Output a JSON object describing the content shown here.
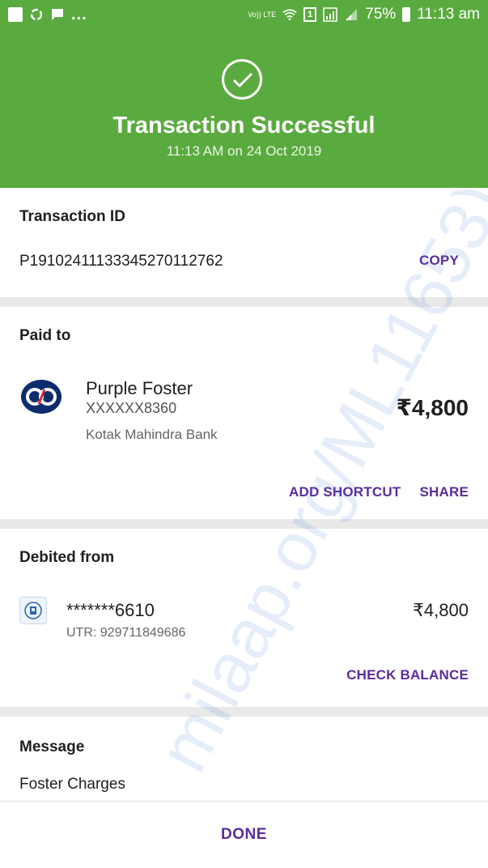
{
  "status_bar": {
    "battery_percent": "75%",
    "time": "11:13 am",
    "overflow_dots": "...",
    "sim_label": "1",
    "volte_label": "Vo)) LTE",
    "icons": [
      "flipboard-icon",
      "sync-icon",
      "message-icon",
      "volte-icon",
      "wifi-icon",
      "sim-icon",
      "signal-icon",
      "signal-2-icon",
      "battery-icon"
    ]
  },
  "header": {
    "title": "Transaction Successful",
    "subtitle": "11:13 AM on 24 Oct 2019",
    "bg_color": "#5aab3f"
  },
  "transaction": {
    "label": "Transaction ID",
    "id": "P19102411133345270112762",
    "copy_label": "COPY"
  },
  "paid_to": {
    "label": "Paid to",
    "name": "Purple Foster",
    "account": "XXXXXX8360",
    "bank": "Kotak Mahindra Bank",
    "amount": "₹4,800",
    "add_shortcut_label": "ADD SHORTCUT",
    "share_label": "SHARE"
  },
  "debited_from": {
    "label": "Debited from",
    "account": "*******6610",
    "utr": "UTR: 929711849686",
    "amount": "₹4,800",
    "check_balance_label": "CHECK BALANCE"
  },
  "message": {
    "label": "Message",
    "text": "Foster Charges"
  },
  "bottom": {
    "done_label": "DONE"
  },
  "watermark": "milaap.org/ML11653)",
  "accent_color": "#5a2d9c"
}
